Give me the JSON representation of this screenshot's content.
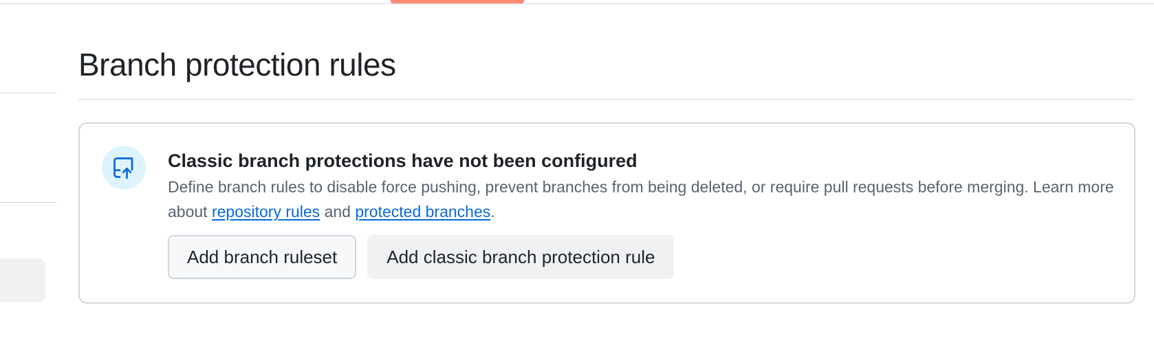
{
  "theme": {
    "accent": "#0969da",
    "tab_underline": "#fd8c73",
    "icon_bg": "#ddf4ff",
    "border": "#d0d7de"
  },
  "page": {
    "title": "Branch protection rules"
  },
  "blankslate": {
    "icon": "repo-push-icon",
    "heading": "Classic branch protections have not been configured",
    "description_before": "Define branch rules to disable force pushing, prevent branches from being deleted, or require pull requests before merging. Learn more about ",
    "link_repository_rules": "repository rules",
    "description_middle": " and ",
    "link_protected_branches": "protected branches",
    "description_after": ".",
    "buttons": {
      "add_ruleset": "Add branch ruleset",
      "add_classic_rule": "Add classic branch protection rule"
    }
  }
}
